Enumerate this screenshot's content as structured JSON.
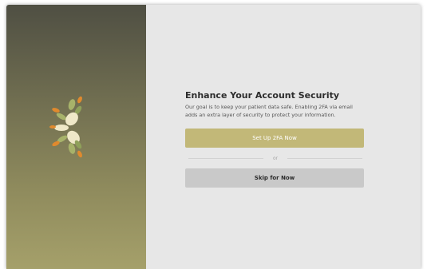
{
  "colors": {
    "panel_top": "#4f4f43",
    "panel_bottom": "#a5a06a",
    "primary_button": "#c2b878",
    "secondary_button": "#c9c9c9",
    "background": "#e7e7e7",
    "logo_orange": "#e08a2e",
    "logo_green": "#a7b26a",
    "logo_cream": "#efe8c8"
  },
  "brand": {
    "logo_icon": "leaf-flower-logo"
  },
  "security": {
    "title": "Enhance Your Account Security",
    "description": "Our goal is to keep your patient data safe. Enabling 2FA via email adds an extra layer of security to protect your information.",
    "primary_button": "Set Up 2FA Now",
    "divider_text": "or",
    "secondary_button": "Skip for Now"
  }
}
